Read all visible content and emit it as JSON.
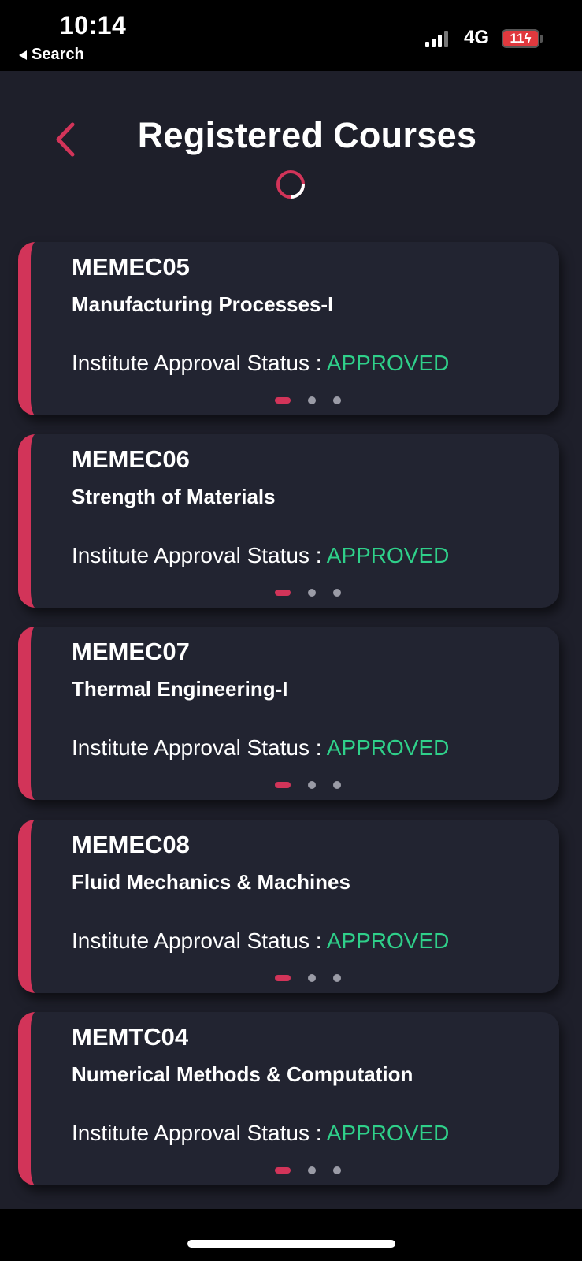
{
  "status_bar": {
    "time": "10:14",
    "back_label": "Search",
    "network": "4G",
    "battery": "11"
  },
  "header": {
    "title": "Registered Courses"
  },
  "colors": {
    "accent": "#d23459",
    "approved": "#2fd08a",
    "background": "#1e1f2a",
    "card": "#222431"
  },
  "courses": [
    {
      "code": "MEMEC05",
      "name": "Manufacturing Processes-I",
      "status_label": "Institute Approval Status :",
      "status": "APPROVED"
    },
    {
      "code": "MEMEC06",
      "name": "Strength of Materials",
      "status_label": "Institute Approval Status :",
      "status": "APPROVED"
    },
    {
      "code": "MEMEC07",
      "name": "Thermal Engineering-I",
      "status_label": "Institute Approval Status :",
      "status": "APPROVED"
    },
    {
      "code": "MEMEC08",
      "name": "Fluid Mechanics & Machines",
      "status_label": "Institute Approval Status :",
      "status": "APPROVED"
    },
    {
      "code": "MEMTC04",
      "name": "Numerical Methods & Computation",
      "status_label": "Institute Approval Status :",
      "status": "APPROVED"
    }
  ]
}
